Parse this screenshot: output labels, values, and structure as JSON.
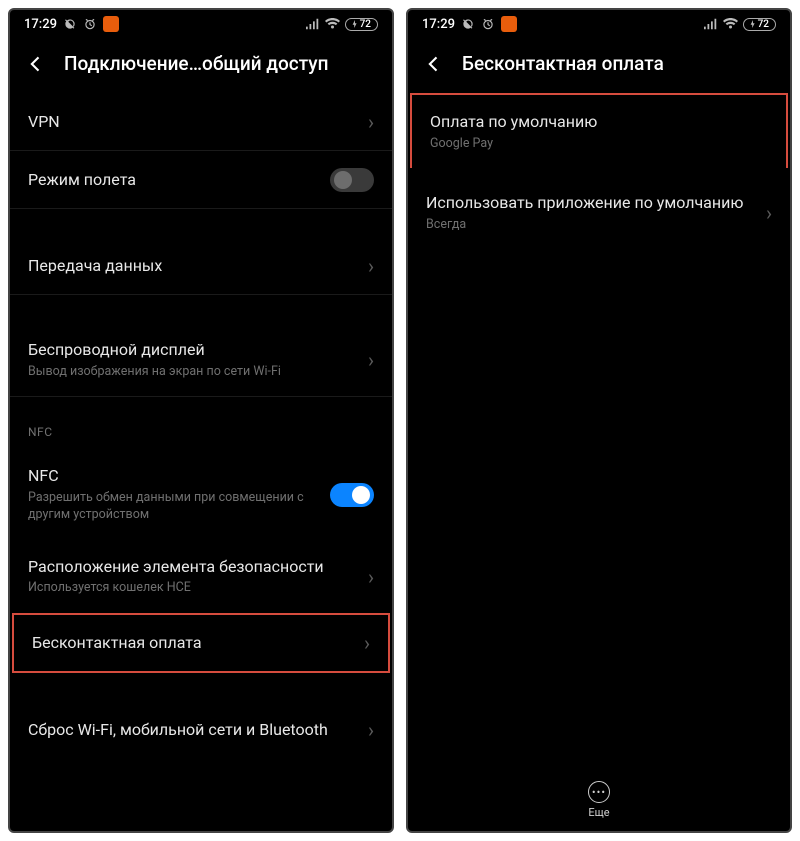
{
  "status": {
    "time": "17:29",
    "battery": "72"
  },
  "left": {
    "title": "Подключение…общий доступ",
    "vpn": "VPN",
    "airplane": "Режим полета",
    "data": "Передача данных",
    "wdisplay": {
      "title": "Беспроводной дисплей",
      "sub": "Вывод изображения на экран по сети Wi-Fi"
    },
    "nfcSection": "NFC",
    "nfc": {
      "title": "NFC",
      "sub": "Разрешить обмен данными при совмещении с другим устройством"
    },
    "secel": {
      "title": "Расположение элемента безопасности",
      "sub": "Используется кошелек HCE"
    },
    "contactless": "Бесконтактная оплата",
    "reset": "Сброс Wi-Fi, мобильной сети и Bluetooth"
  },
  "right": {
    "title": "Бесконтактная оплата",
    "defaultPay": {
      "title": "Оплата по умолчанию",
      "sub": "Google Pay"
    },
    "useDefault": {
      "title": "Использовать приложение по умолчанию",
      "sub": "Всегда"
    },
    "more": "Еще"
  }
}
